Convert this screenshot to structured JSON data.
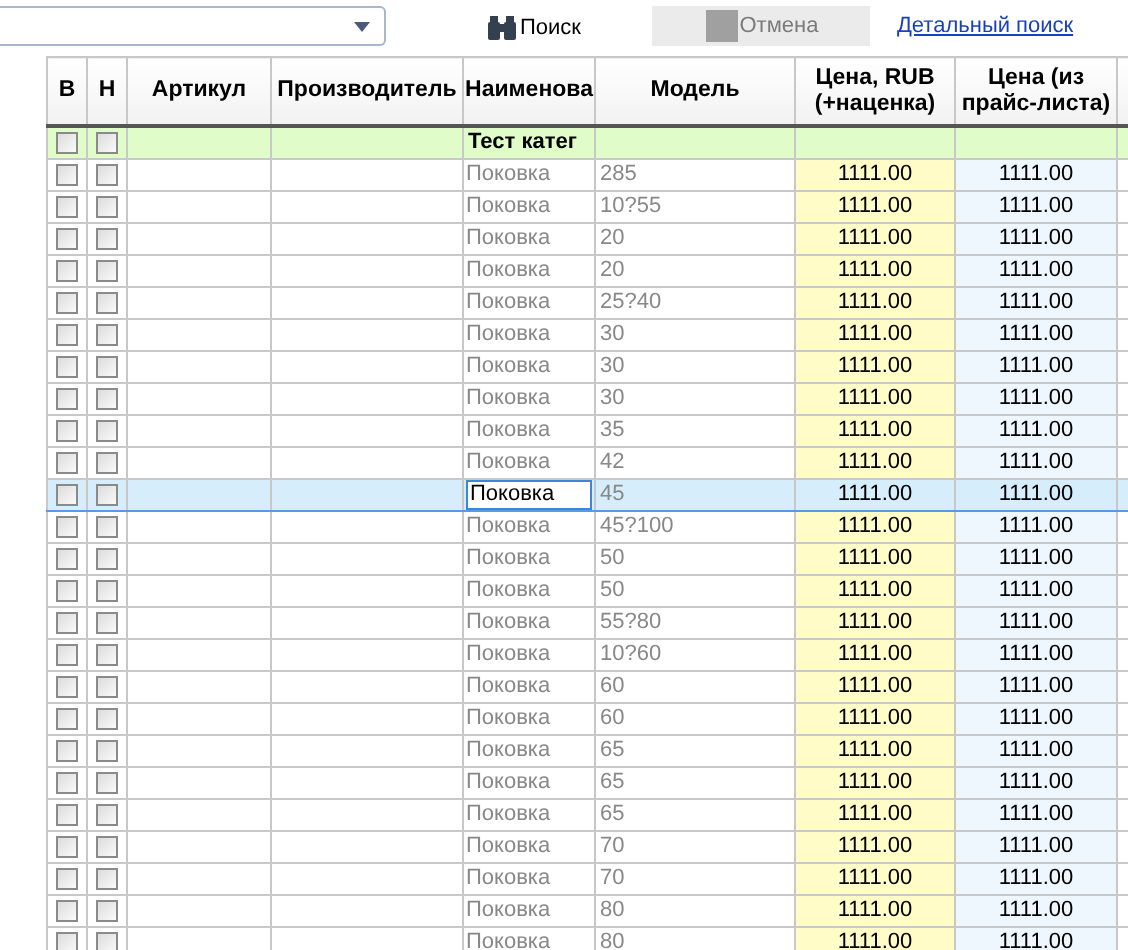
{
  "toolbar": {
    "search_button": "Поиск",
    "cancel_button": {
      "label": "Отмена",
      "disabled": true
    },
    "advanced_link": "Детальный поиск"
  },
  "table": {
    "columns": [
      "В",
      "Н",
      "Артикул",
      "Производитель",
      "Наименова",
      "Модель",
      "Цена, RUB (+наценка)",
      "Цена (из прайс-листа)"
    ],
    "category": {
      "title": "Тест катег",
      "b": false,
      "n": false
    },
    "rows": [
      {
        "name": "Поковка",
        "model": "285",
        "price": "1111.00",
        "list_price": "1111.00",
        "b": false,
        "n": false,
        "selected": false
      },
      {
        "name": "Поковка",
        "model": "10?55",
        "price": "1111.00",
        "list_price": "1111.00",
        "b": false,
        "n": false,
        "selected": false
      },
      {
        "name": "Поковка",
        "model": "20",
        "price": "1111.00",
        "list_price": "1111.00",
        "b": false,
        "n": false,
        "selected": false
      },
      {
        "name": "Поковка",
        "model": "20",
        "price": "1111.00",
        "list_price": "1111.00",
        "b": false,
        "n": false,
        "selected": false
      },
      {
        "name": "Поковка",
        "model": "25?40",
        "price": "1111.00",
        "list_price": "1111.00",
        "b": false,
        "n": false,
        "selected": false
      },
      {
        "name": "Поковка",
        "model": "30",
        "price": "1111.00",
        "list_price": "1111.00",
        "b": false,
        "n": false,
        "selected": false
      },
      {
        "name": "Поковка",
        "model": "30",
        "price": "1111.00",
        "list_price": "1111.00",
        "b": false,
        "n": false,
        "selected": false
      },
      {
        "name": "Поковка",
        "model": "30",
        "price": "1111.00",
        "list_price": "1111.00",
        "b": false,
        "n": false,
        "selected": false
      },
      {
        "name": "Поковка",
        "model": "35",
        "price": "1111.00",
        "list_price": "1111.00",
        "b": false,
        "n": false,
        "selected": false
      },
      {
        "name": "Поковка",
        "model": "42",
        "price": "1111.00",
        "list_price": "1111.00",
        "b": false,
        "n": false,
        "selected": false
      },
      {
        "name": "Поковка",
        "model": "45",
        "price": "1111.00",
        "list_price": "1111.00",
        "b": false,
        "n": false,
        "selected": true
      },
      {
        "name": "Поковка",
        "model": "45?100",
        "price": "1111.00",
        "list_price": "1111.00",
        "b": false,
        "n": false,
        "selected": false
      },
      {
        "name": "Поковка",
        "model": "50",
        "price": "1111.00",
        "list_price": "1111.00",
        "b": false,
        "n": false,
        "selected": false
      },
      {
        "name": "Поковка",
        "model": "50",
        "price": "1111.00",
        "list_price": "1111.00",
        "b": false,
        "n": false,
        "selected": false
      },
      {
        "name": "Поковка",
        "model": "55?80",
        "price": "1111.00",
        "list_price": "1111.00",
        "b": false,
        "n": false,
        "selected": false
      },
      {
        "name": "Поковка",
        "model": "10?60",
        "price": "1111.00",
        "list_price": "1111.00",
        "b": false,
        "n": false,
        "selected": false
      },
      {
        "name": "Поковка",
        "model": "60",
        "price": "1111.00",
        "list_price": "1111.00",
        "b": false,
        "n": false,
        "selected": false
      },
      {
        "name": "Поковка",
        "model": "60",
        "price": "1111.00",
        "list_price": "1111.00",
        "b": false,
        "n": false,
        "selected": false
      },
      {
        "name": "Поковка",
        "model": "65",
        "price": "1111.00",
        "list_price": "1111.00",
        "b": false,
        "n": false,
        "selected": false
      },
      {
        "name": "Поковка",
        "model": "65",
        "price": "1111.00",
        "list_price": "1111.00",
        "b": false,
        "n": false,
        "selected": false
      },
      {
        "name": "Поковка",
        "model": "65",
        "price": "1111.00",
        "list_price": "1111.00",
        "b": false,
        "n": false,
        "selected": false
      },
      {
        "name": "Поковка",
        "model": "70",
        "price": "1111.00",
        "list_price": "1111.00",
        "b": false,
        "n": false,
        "selected": false
      },
      {
        "name": "Поковка",
        "model": "70",
        "price": "1111.00",
        "list_price": "1111.00",
        "b": false,
        "n": false,
        "selected": false
      },
      {
        "name": "Поковка",
        "model": "80",
        "price": "1111.00",
        "list_price": "1111.00",
        "b": false,
        "n": false,
        "selected": false
      },
      {
        "name": "Поковка",
        "model": "80",
        "price": "1111.00",
        "list_price": "1111.00",
        "b": false,
        "n": false,
        "selected": false
      }
    ]
  }
}
